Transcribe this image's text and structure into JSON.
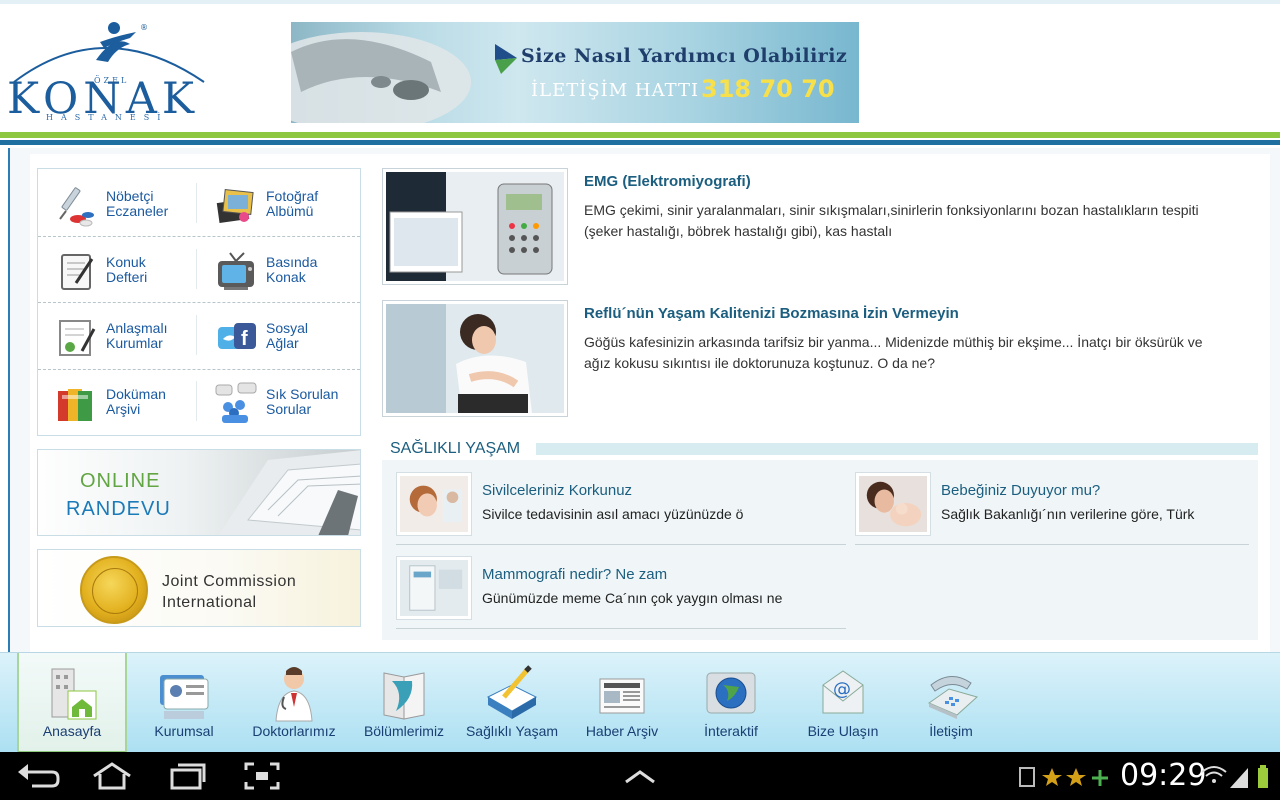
{
  "header": {
    "logo": {
      "ozel": "ÖZEL",
      "name": "KONAK",
      "hastanesi": "HASTANESİ"
    },
    "banner": {
      "line1": "Size Nasıl Yardımcı Olabiliriz",
      "line2": "İLETİŞİM HATTI",
      "phone": "318 70 70"
    }
  },
  "sidebar": {
    "tiles": [
      {
        "label": "Nöbetçi\nEczaneler",
        "icon": "syringe-pills-icon"
      },
      {
        "label": "Fotoğraf\nAlbümü",
        "icon": "photo-album-icon"
      },
      {
        "label": "Konuk\nDefteri",
        "icon": "guestbook-icon"
      },
      {
        "label": "Basında\nKonak",
        "icon": "tv-icon"
      },
      {
        "label": "Anlaşmalı\nKurumlar",
        "icon": "certificate-icon"
      },
      {
        "label": "Sosyal\nAğlar",
        "icon": "social-icon"
      },
      {
        "label": "Doküman\nArşivi",
        "icon": "folders-icon"
      },
      {
        "label": "Sık Sorulan\nSorular",
        "icon": "chat-people-icon"
      }
    ],
    "online": {
      "line1": "ONLINE",
      "line2": "RANDEVU"
    },
    "jci": {
      "line1": "Joint Commission",
      "line2": "International"
    }
  },
  "news": [
    {
      "title": "EMG (Elektromiyografi)",
      "desc": "EMG çekimi, sinir yaralanmaları, sinir sıkışmaları,sinirlerin fonksiyonlarını bozan hastalıkların tespiti\n(şeker hastalığı, böbrek hastalığı gibi), kas hastalı"
    },
    {
      "title": "Reflü´nün Yaşam Kalitenizi Bozmasına İzin Vermeyin",
      "desc": "Göğüs kafesinizin arkasında tarifsiz bir yanma... Midenizde müthiş bir ekşime... İnatçı bir öksürük ve\nağız kokusu sıkıntısı ile doktorunuza koştunuz. O da ne?"
    }
  ],
  "saglikli_yasam": {
    "heading": "SAĞLIKLI YAŞAM",
    "items": [
      {
        "title": "Sivilceleriniz Korkunuz",
        "desc": "Sivilce tedavisinin asıl amacı yüzünüzde ö"
      },
      {
        "title": "Bebeğiniz Duyuyor mu?",
        "desc": "Sağlık Bakanlığı´nın verilerine göre, Türk"
      },
      {
        "title": "Mammografi nedir? Ne zam",
        "desc": "Günümüzde meme Ca´nın çok yaygın olması ne"
      }
    ]
  },
  "bottom_nav": [
    {
      "label": "Anasayfa",
      "icon": "home-building-icon",
      "active": true
    },
    {
      "label": "Kurumsal",
      "icon": "id-card-icon"
    },
    {
      "label": "Doktorlarımız",
      "icon": "doctor-icon"
    },
    {
      "label": "Bölümlerimiz",
      "icon": "book-icon"
    },
    {
      "label": "Sağlıklı Yaşam",
      "icon": "notepad-pencil-icon"
    },
    {
      "label": "Haber Arşiv",
      "icon": "newspaper-icon"
    },
    {
      "label": "İnteraktif",
      "icon": "globe-icon"
    },
    {
      "label": "Bize Ulaşın",
      "icon": "envelope-at-icon"
    },
    {
      "label": "İletişim",
      "icon": "telephone-icon"
    }
  ],
  "status_bar": {
    "time": "09:29"
  },
  "colors": {
    "brand_blue": "#1c5d9d",
    "brand_green": "#8dc63f",
    "title_teal": "#1b5e7f"
  }
}
